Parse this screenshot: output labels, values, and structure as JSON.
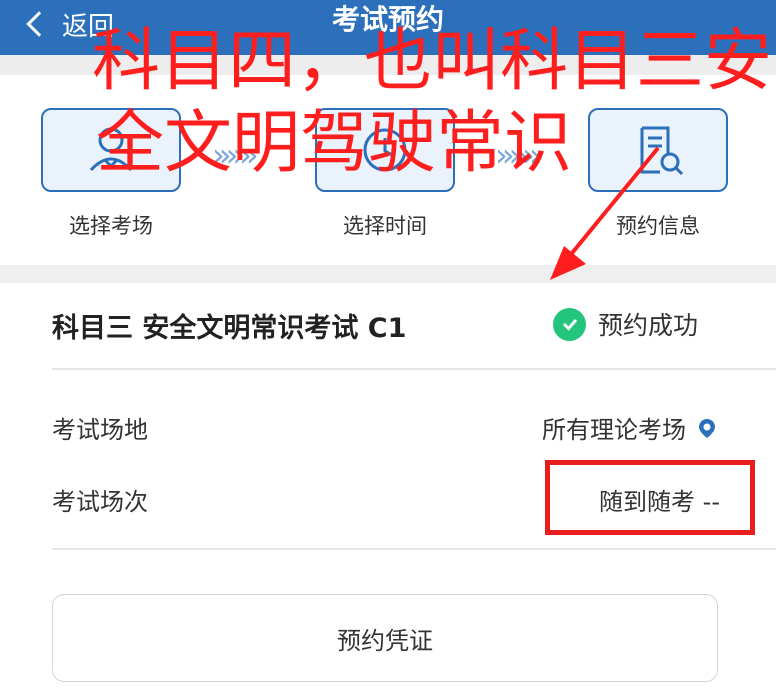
{
  "header": {
    "back_label": "返回",
    "title": "考试预约"
  },
  "steps": [
    {
      "label": "选择考场"
    },
    {
      "label": "选择时间"
    },
    {
      "label": "预约信息"
    }
  ],
  "exam": {
    "title": "科目三 安全文明常识考试 C1",
    "status": "预约成功",
    "rows": [
      {
        "label": "考试场地",
        "value": "所有理论考场"
      },
      {
        "label": "考试场次",
        "value": "随到随考 --"
      }
    ],
    "voucher_label": "预约凭证"
  },
  "annotation": {
    "line1": "科目四，也叫科目三安",
    "line2": "全文明驾驶常识"
  },
  "colors": {
    "primary": "#2c6fba",
    "success": "#23c47b",
    "annotation": "#ff1e1e"
  }
}
